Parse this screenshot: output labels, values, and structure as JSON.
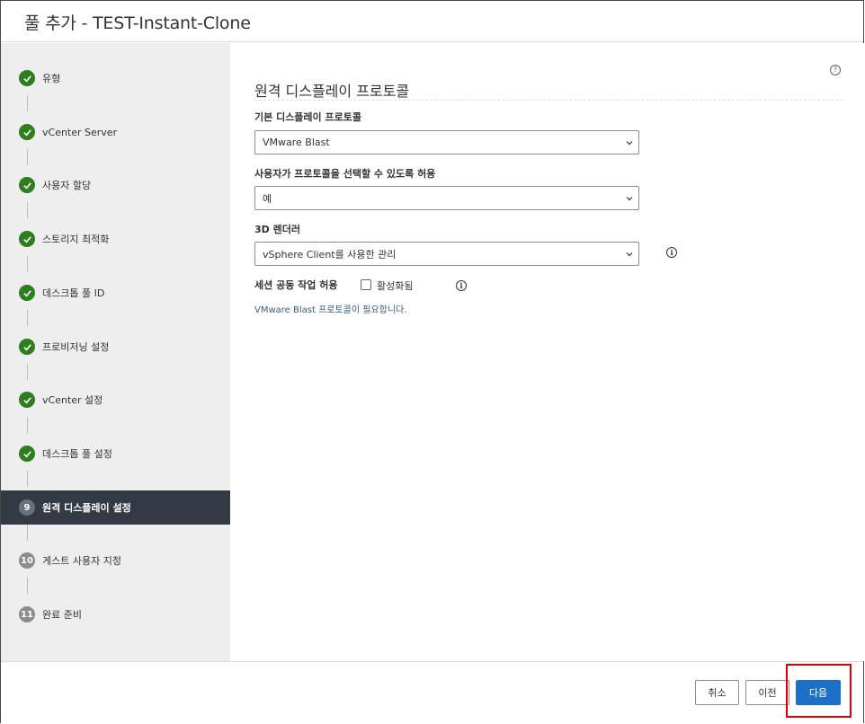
{
  "window": {
    "title": "풀 추가 - TEST-Instant-Clone"
  },
  "steps": [
    {
      "label": "유형",
      "num": "1",
      "state": "done"
    },
    {
      "label": "vCenter Server",
      "num": "2",
      "state": "done"
    },
    {
      "label": "사용자 할당",
      "num": "3",
      "state": "done"
    },
    {
      "label": "스토리지 최적화",
      "num": "4",
      "state": "done"
    },
    {
      "label": "데스크톱 풀 ID",
      "num": "5",
      "state": "done"
    },
    {
      "label": "프로비저닝 설정",
      "num": "6",
      "state": "done"
    },
    {
      "label": "vCenter 설정",
      "num": "7",
      "state": "done"
    },
    {
      "label": "데스크톱 풀 설정",
      "num": "8",
      "state": "done"
    },
    {
      "label": "원격 디스플레이 설정",
      "num": "9",
      "state": "current"
    },
    {
      "label": "게스트 사용자 지정",
      "num": "10",
      "state": "pending"
    },
    {
      "label": "완료 준비",
      "num": "11",
      "state": "pending"
    }
  ],
  "main": {
    "help_icon": "?",
    "section_title": "원격 디스플레이 프로토콜",
    "fields": {
      "default_protocol": {
        "label": "기본 디스플레이 프로토콜",
        "value": "VMware Blast"
      },
      "allow_user_choose": {
        "label": "사용자가 프로토콜을 선택할 수 있도록 허용",
        "value": "예"
      },
      "renderer_3d": {
        "label": "3D 렌더러",
        "value": "vSphere Client를 사용한 관리"
      },
      "session_collab": {
        "label": "세션 공동 작업 허용",
        "checkbox_label": "활성화됨",
        "checked": false
      }
    },
    "info_glyph": "i",
    "note": "VMware Blast 프로토콜이 필요합니다."
  },
  "footer": {
    "cancel_label": "취소",
    "back_label": "이전",
    "next_label": "다음"
  },
  "colors": {
    "done": "#2e7d1f",
    "active_bg": "#343a44",
    "primary": "#1c70c8",
    "highlight": "#e00000"
  }
}
